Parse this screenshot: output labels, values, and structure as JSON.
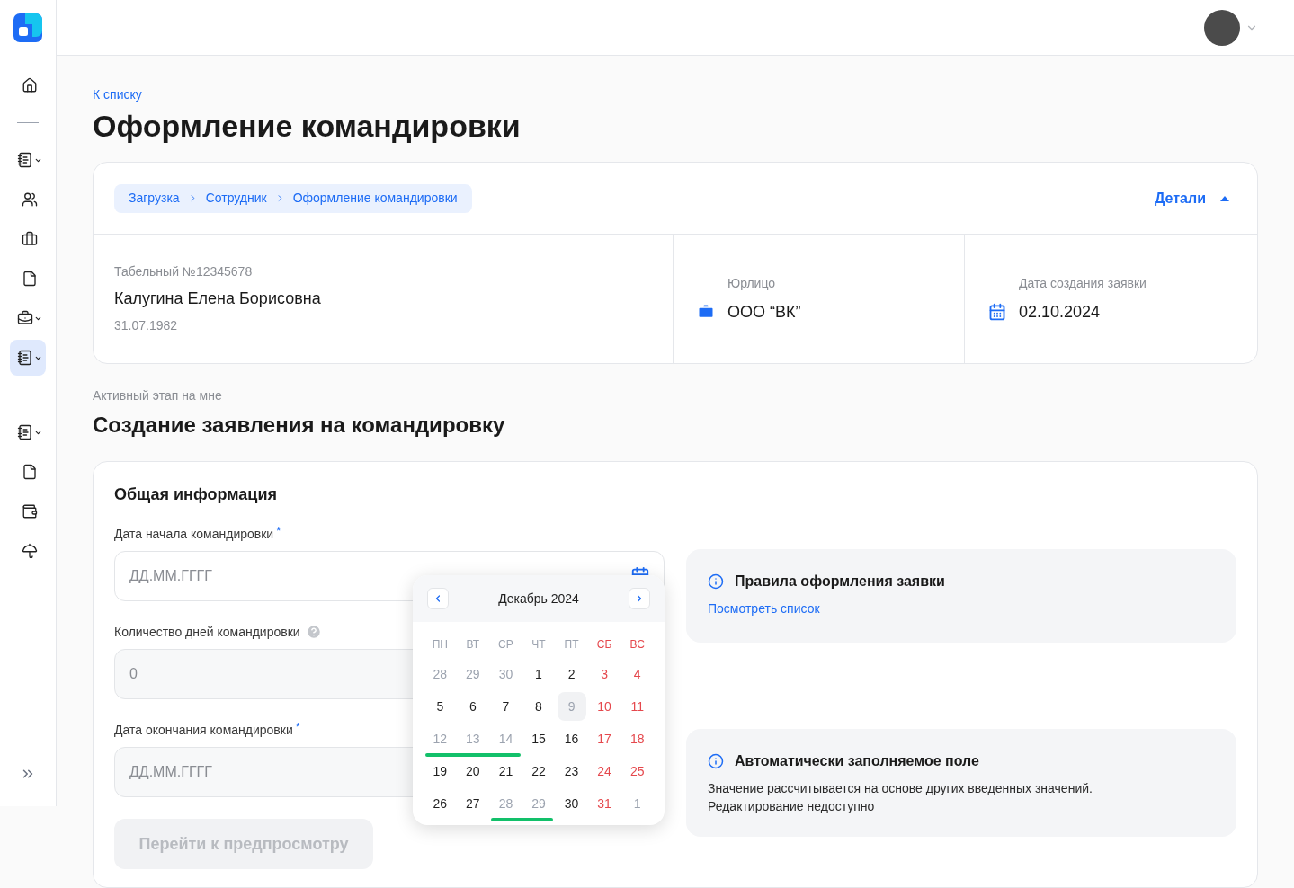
{
  "sidebar": {
    "groups": [
      [
        {
          "selected": false,
          "has_menu": false
        }
      ],
      [
        {
          "selected": false,
          "has_menu": true
        },
        {
          "selected": false,
          "has_menu": false
        },
        {
          "selected": false,
          "has_menu": false
        },
        {
          "selected": false,
          "has_menu": false
        },
        {
          "selected": false,
          "has_menu": true
        },
        {
          "selected": true,
          "has_menu": true
        }
      ],
      [
        {
          "selected": false,
          "has_menu": true
        },
        {
          "selected": false,
          "has_menu": false
        },
        {
          "selected": false,
          "has_menu": false
        },
        {
          "selected": false,
          "has_menu": false
        }
      ]
    ]
  },
  "back_link": "К списку",
  "title": "Оформление командировки",
  "summary": {
    "breadcrumbs": [
      "Загрузка",
      "Сотрудник",
      "Оформление командировки"
    ],
    "details_toggle": {
      "label": "Детали",
      "expanded": true
    },
    "employee": {
      "number": "Табельный №12345678",
      "name": "Калугина Елена Борисовна",
      "birth_date": "31.07.1982"
    },
    "entity": {
      "label": "Юрлицо",
      "value": "ООО “ВК”"
    },
    "created": {
      "label": "Дата создания заявки",
      "value": "02.10.2024"
    }
  },
  "stage": {
    "caption": "Активный этап на мне",
    "title": "Создание заявления на командировку"
  },
  "form": {
    "title": "Общая информация",
    "fields": [
      {
        "kind": "date",
        "label": "Дата начала командировки",
        "required_mark": "*",
        "help": false,
        "active": true,
        "placeholder": "ДД.ММ.ГГГГ"
      },
      {
        "kind": "number",
        "label": "Количество дней командировки",
        "help": true,
        "active": false,
        "placeholder": "0"
      },
      {
        "kind": "date",
        "label": "Дата окончания командировки",
        "required_mark": "*",
        "help": false,
        "active": false,
        "placeholder": "ДД.ММ.ГГГГ"
      }
    ],
    "submit": {
      "label": "Перейти к предпросмотру",
      "disabled": true
    },
    "notes": [
      {
        "title": "Правила оформления заявки",
        "link": "Посмотреть список"
      },
      {
        "title": "Автоматически заполняемое поле",
        "text": "Значение рассчитывается на основе других введенных значений. Редактирование недоступно"
      }
    ]
  },
  "calendar": {
    "month": "Декабрь 2024",
    "weekdays": [
      {
        "label": "ПН",
        "weekend": false
      },
      {
        "label": "ВТ",
        "weekend": false
      },
      {
        "label": "СР",
        "weekend": false
      },
      {
        "label": "ЧТ",
        "weekend": false
      },
      {
        "label": "ПТ",
        "weekend": false
      },
      {
        "label": "СБ",
        "weekend": true
      },
      {
        "label": "ВС",
        "weekend": true
      }
    ],
    "weeks": [
      [
        {
          "label": "28",
          "kind": "outside",
          "marked": false
        },
        {
          "label": "29",
          "kind": "outside",
          "marked": false
        },
        {
          "label": "30",
          "kind": "outside",
          "marked": false
        },
        {
          "label": "1",
          "kind": "regular",
          "marked": false
        },
        {
          "label": "2",
          "kind": "regular",
          "marked": false
        },
        {
          "label": "3",
          "kind": "weekend",
          "marked": false
        },
        {
          "label": "4",
          "kind": "weekend",
          "marked": false
        }
      ],
      [
        {
          "label": "5",
          "kind": "regular",
          "marked": false
        },
        {
          "label": "6",
          "kind": "regular",
          "marked": false
        },
        {
          "label": "7",
          "kind": "regular",
          "marked": false
        },
        {
          "label": "8",
          "kind": "regular",
          "marked": false
        },
        {
          "label": "9",
          "kind": "focused",
          "marked": false
        },
        {
          "label": "10",
          "kind": "weekend",
          "marked": false
        },
        {
          "label": "11",
          "kind": "weekend",
          "marked": false
        }
      ],
      [
        {
          "label": "12",
          "kind": "unavailable",
          "marked": true
        },
        {
          "label": "13",
          "kind": "unavailable",
          "marked": true
        },
        {
          "label": "14",
          "kind": "unavailable",
          "marked": true
        },
        {
          "label": "15",
          "kind": "regular",
          "marked": false
        },
        {
          "label": "16",
          "kind": "regular",
          "marked": false
        },
        {
          "label": "17",
          "kind": "weekend",
          "marked": false
        },
        {
          "label": "18",
          "kind": "weekend",
          "marked": false
        }
      ],
      [
        {
          "label": "19",
          "kind": "regular",
          "marked": false
        },
        {
          "label": "20",
          "kind": "regular",
          "marked": false
        },
        {
          "label": "21",
          "kind": "regular",
          "marked": false
        },
        {
          "label": "22",
          "kind": "regular",
          "marked": false
        },
        {
          "label": "23",
          "kind": "regular",
          "marked": false
        },
        {
          "label": "24",
          "kind": "weekend",
          "marked": false
        },
        {
          "label": "25",
          "kind": "weekend",
          "marked": false
        }
      ],
      [
        {
          "label": "26",
          "kind": "regular",
          "marked": false
        },
        {
          "label": "27",
          "kind": "regular",
          "marked": false
        },
        {
          "label": "28",
          "kind": "unavailable",
          "marked": true
        },
        {
          "label": "29",
          "kind": "unavailable",
          "marked": true
        },
        {
          "label": "30",
          "kind": "regular",
          "marked": false
        },
        {
          "label": "31",
          "kind": "weekend",
          "marked": false
        },
        {
          "label": "1",
          "kind": "outside",
          "marked": false
        }
      ]
    ]
  }
}
